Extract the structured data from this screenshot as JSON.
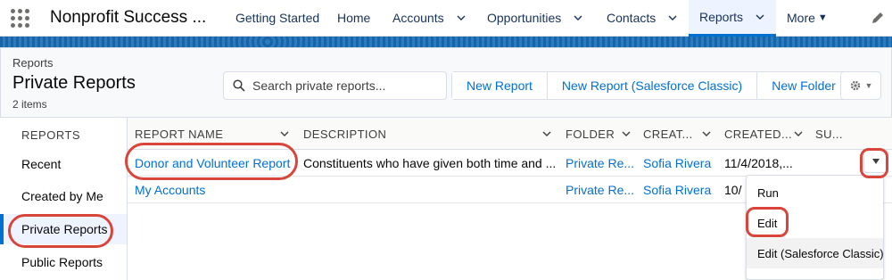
{
  "app": {
    "name": "Nonprofit Success ..."
  },
  "nav": {
    "items": [
      {
        "label": "Getting Started",
        "chevron": false,
        "active": false
      },
      {
        "label": "Home",
        "chevron": false,
        "active": false
      },
      {
        "label": "Accounts",
        "chevron": true,
        "active": false
      },
      {
        "label": "Opportunities",
        "chevron": true,
        "active": false
      },
      {
        "label": "Contacts",
        "chevron": true,
        "active": false
      },
      {
        "label": "Reports",
        "chevron": true,
        "active": true
      }
    ],
    "more_label": "More"
  },
  "header": {
    "breadcrumb": "Reports",
    "title": "Private Reports",
    "count": "2 items",
    "search_placeholder": "Search private reports...",
    "buttons": [
      "New Report",
      "New Report (Salesforce Classic)",
      "New Folder"
    ]
  },
  "sidebar": {
    "heading": "REPORTS",
    "items": [
      {
        "label": "Recent",
        "selected": false
      },
      {
        "label": "Created by Me",
        "selected": false
      },
      {
        "label": "Private Reports",
        "selected": true
      },
      {
        "label": "Public Reports",
        "selected": false
      }
    ]
  },
  "table": {
    "columns": [
      "REPORT NAME",
      "DESCRIPTION",
      "FOLDER",
      "CREAT...",
      "CREATED...",
      "SU..."
    ],
    "rows": [
      {
        "name": "Donor and Volunteer Report",
        "description": "Constituents who have given both time and ...",
        "folder": "Private Re...",
        "created_by": "Sofia Rivera",
        "created_date": "11/4/2018,..."
      },
      {
        "name": "My Accounts",
        "description": "",
        "folder": "Private Re...",
        "created_by": "Sofia Rivera",
        "created_date": "10/"
      }
    ]
  },
  "row_menu": {
    "items": [
      "Run",
      "Edit",
      "Edit (Salesforce Classic)"
    ]
  },
  "colors": {
    "accent": "#0070d2",
    "callout": "#d9453b",
    "text_dark": "#080707"
  }
}
